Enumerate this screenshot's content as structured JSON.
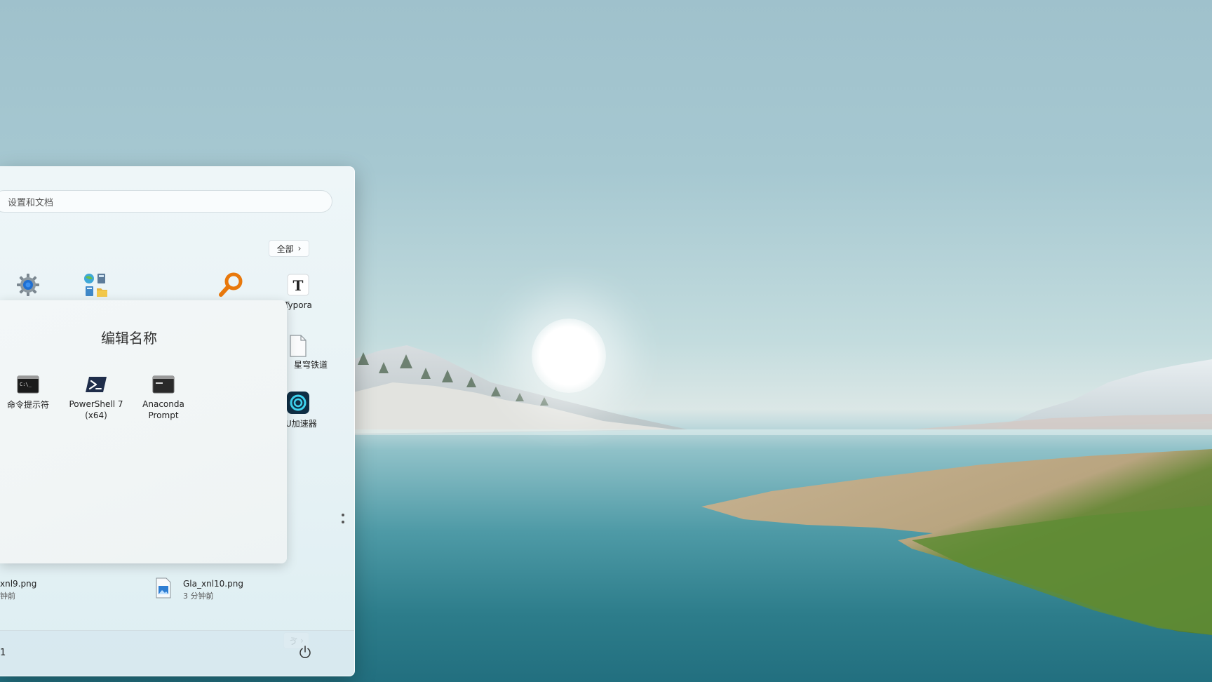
{
  "search": {
    "placeholder": "设置和文档"
  },
  "pinned": {
    "all_label": "全部",
    "row1": [
      {
        "name": "settings",
        "label": ""
      },
      {
        "name": "control-panel",
        "label": ""
      },
      {
        "name": "everything",
        "label": ""
      },
      {
        "name": "typora",
        "label": "Typora"
      }
    ],
    "row2_partial": [
      {
        "name": "star-rail",
        "label_prefix": "：",
        "label": "星穹铁道"
      }
    ],
    "row3_partial": [
      {
        "name": "accelerator",
        "label": "U加速器"
      }
    ],
    "more_label": "ゔ"
  },
  "folder": {
    "title": "编辑名称",
    "apps": [
      {
        "name": "cmd",
        "label": "命令提示符"
      },
      {
        "name": "powershell",
        "label_line1": "PowerShell 7",
        "label_line2": "(x64)"
      },
      {
        "name": "anaconda",
        "label_line1": "Anaconda",
        "label_line2": "Prompt"
      }
    ]
  },
  "recommended": [
    {
      "name": "xnl9.png",
      "time": "钟前"
    },
    {
      "name": "Gla_xnl10.png",
      "time": "3 分钟前"
    }
  ],
  "footer": {
    "user_fragment": "1"
  },
  "colors": {
    "accent": "#0067c0",
    "panel": "#e9f3f6",
    "everything_orange": "#e8780c"
  }
}
